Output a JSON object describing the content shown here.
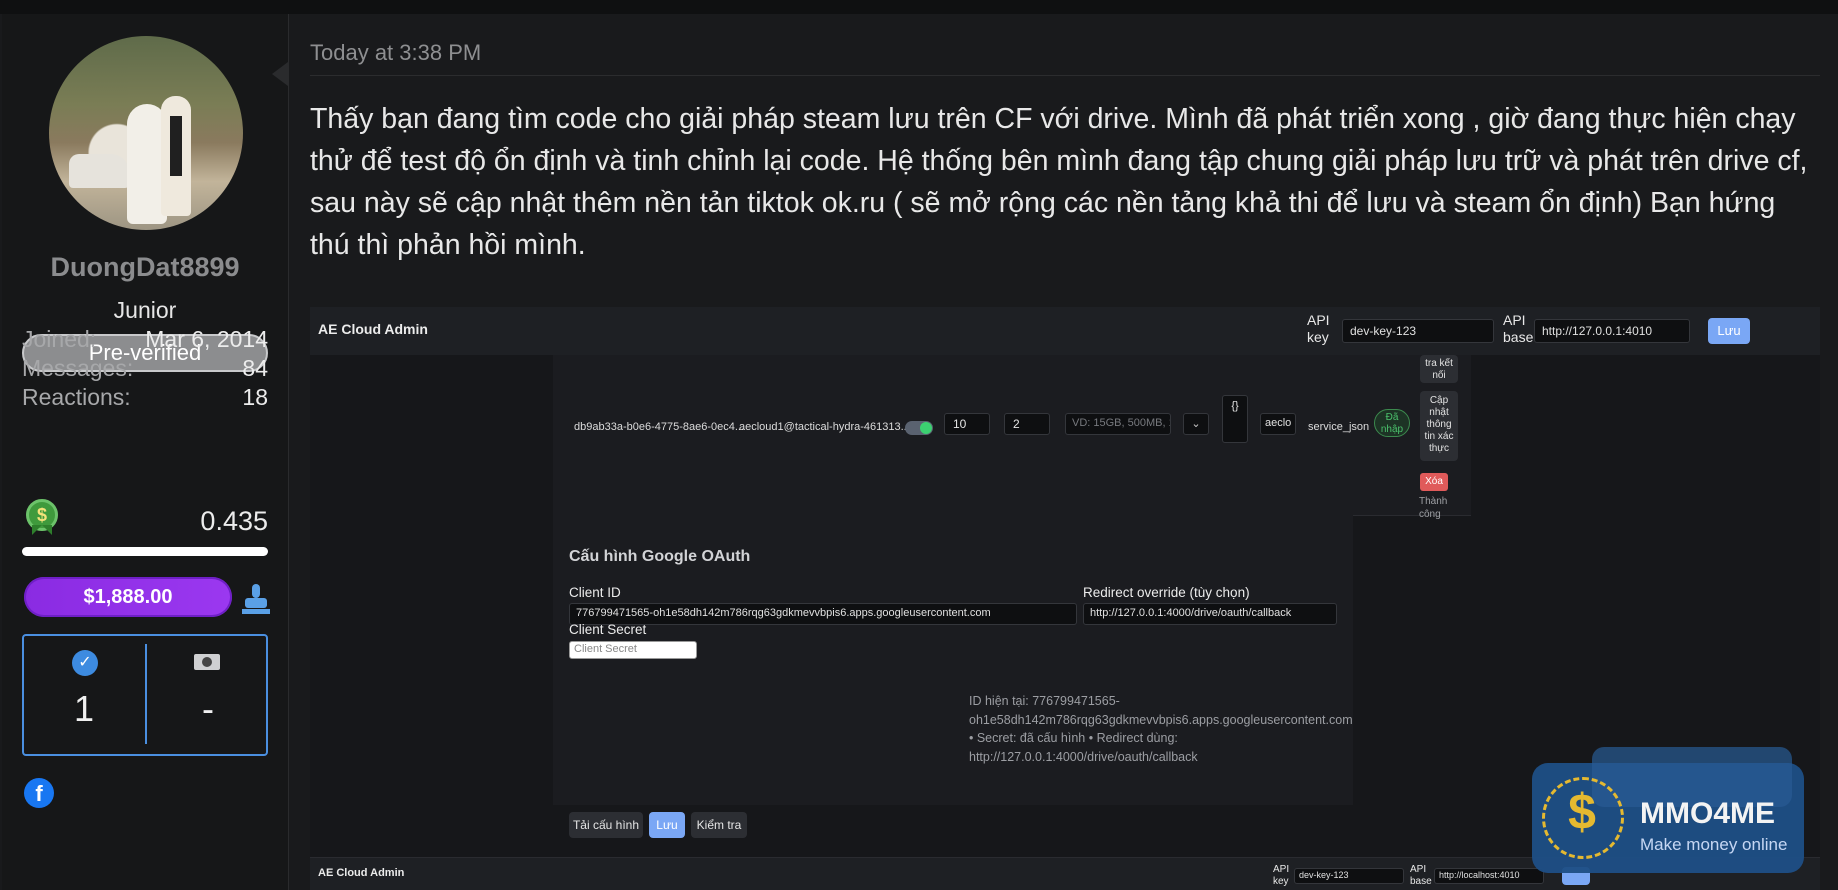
{
  "user": {
    "username": "DuongDat8899",
    "title": "Junior",
    "badge": "Pre-verified",
    "stats": [
      {
        "label": "Joined:",
        "value": "Mar 6, 2014"
      },
      {
        "label": "Messages:",
        "value": "84"
      },
      {
        "label": "Reactions:",
        "value": "18"
      }
    ],
    "points": "0.435",
    "points_progress": 1.0,
    "balance": "$1,888.00",
    "trophy_left": "1",
    "trophy_right": "-",
    "social_icon": "facebook-icon"
  },
  "post": {
    "timestamp": "Today at 3:38 PM",
    "body": "Thấy bạn đang tìm code cho giải pháp steam lưu trên CF với drive. Mình đã phát triển xong , giờ đang thực hiện chạy thử để test độ ổn định và tinh chỉnh lại code. Hệ thống bên mình đang tập chung giải pháp lưu trữ và phát trên drive cf, sau này sẽ cập nhật thêm nền tản tiktok ok.ru ( sẽ mở rộng các nền tảng khả thi để lưu và steam ổn định) Bạn hứng thú thì phản hồi mình."
  },
  "screenshot": {
    "brand": "AE Cloud Admin",
    "api_key_label": "API key",
    "api_key_value": "dev-key-123",
    "api_base_label": "API base",
    "api_base_value": "http://127.0.0.1:4010",
    "save_label": "Lưu",
    "row": {
      "id": "db9ab33a-b0e6-4775-8ae6-0ec4...",
      "email": "aecloud1@tactical-hydra-461313...",
      "num1": "10",
      "num2": "2",
      "quota_placeholder": "VD: 15GB, 500MB, 1",
      "json": "{}",
      "short": "aeclo",
      "type": "service_json",
      "status": "Đã nhập",
      "btn_check": "tra kết nối",
      "btn_update": "Cập nhật thông tin xác thực",
      "btn_delete": "Xóa",
      "result": "Thành công"
    },
    "oauth": {
      "heading": "Cấu hình Google OAuth",
      "client_id_label": "Client ID",
      "client_id_value": "776799471565-oh1e58dh142m786rqg63gdkmevvbpis6.apps.googleusercontent.com",
      "redirect_label": "Redirect override (tùy chọn)",
      "redirect_value": "http://127.0.0.1:4000/drive/oauth/callback",
      "secret_label": "Client Secret",
      "secret_placeholder": "Client Secret",
      "hint": "ID hiện tại: 776799471565-oh1e58dh142m786rqg63gdkmevvbpis6.apps.googleusercontent.com • Secret: đã cấu hình • Redirect dùng: http://127.0.0.1:4000/drive/oauth/callback",
      "btn_reload": "Tải cấu hình",
      "btn_save": "Lưu",
      "btn_check": "Kiểm tra"
    },
    "bar2": {
      "brand": "AE Cloud Admin",
      "api_key_label": "API key",
      "api_key_value": "dev-key-123",
      "api_base_label": "API base",
      "api_base_value": "http://localhost:4010"
    }
  },
  "watermark": {
    "name": "MMO4ME",
    "tagline": "Make money online"
  }
}
